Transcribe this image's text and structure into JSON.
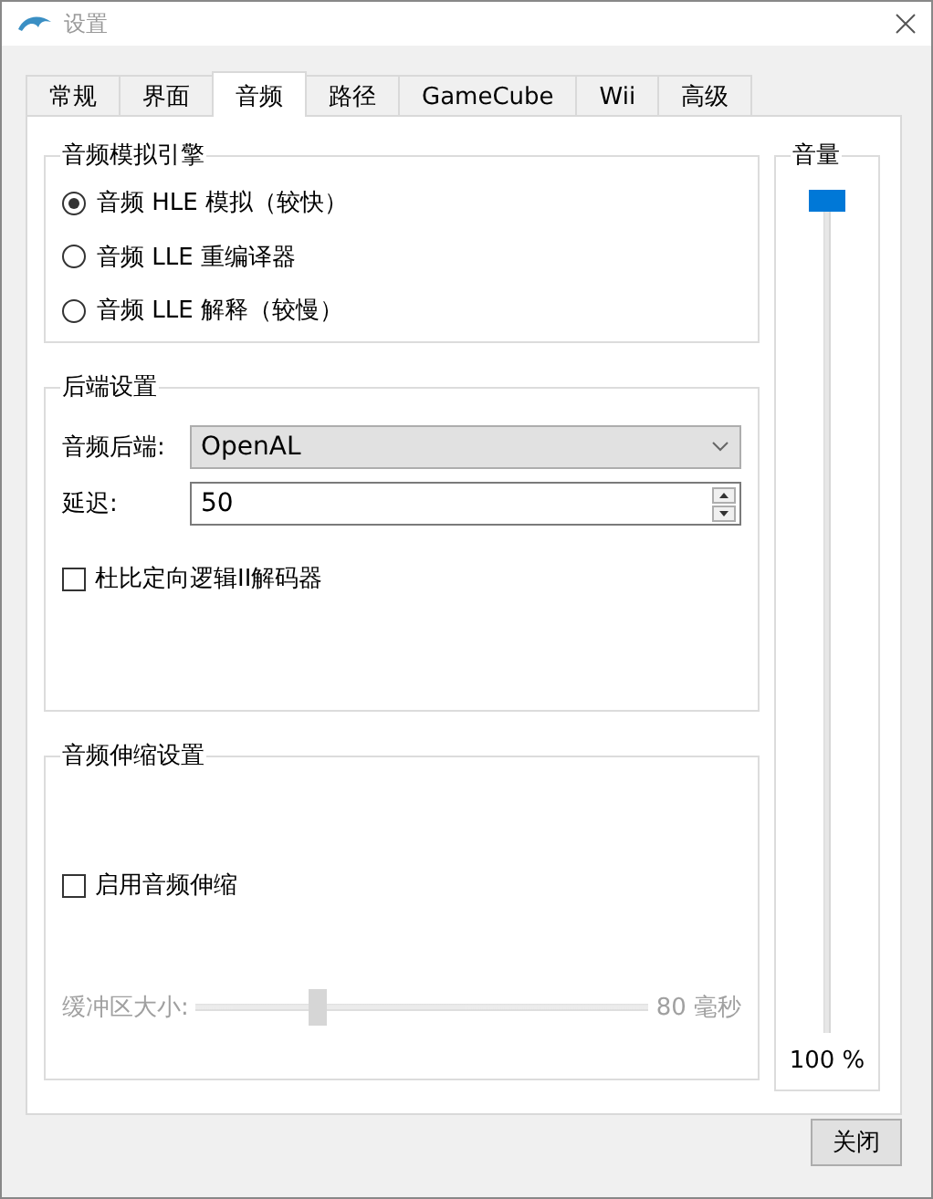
{
  "window": {
    "title": "设置"
  },
  "tabs": [
    {
      "label": "常规",
      "selected": false
    },
    {
      "label": "界面",
      "selected": false
    },
    {
      "label": "音频",
      "selected": true
    },
    {
      "label": "路径",
      "selected": false
    },
    {
      "label": "GameCube",
      "selected": false
    },
    {
      "label": "Wii",
      "selected": false
    },
    {
      "label": "高级",
      "selected": false
    }
  ],
  "audio_engine": {
    "title": "音频模拟引擎",
    "options": [
      {
        "label": "音频 HLE 模拟（较快）",
        "selected": true
      },
      {
        "label": "音频 LLE 重编译器",
        "selected": false
      },
      {
        "label": "音频 LLE 解释（较慢）",
        "selected": false
      }
    ]
  },
  "backend": {
    "title": "后端设置",
    "backend_label": "音频后端:",
    "backend_value": "OpenAL",
    "latency_label": "延迟:",
    "latency_value": "50",
    "dpl2": {
      "label": "杜比定向逻辑II解码器",
      "checked": false
    }
  },
  "stretch": {
    "title": "音频伸缩设置",
    "enable": {
      "label": "启用音频伸缩",
      "checked": false
    },
    "buffer": {
      "label": "缓冲区大小:",
      "level": 0.26,
      "reading": "80 毫秒",
      "disabled": true
    }
  },
  "volume": {
    "title": "音量",
    "level": 1,
    "reading": "100 %"
  },
  "buttons": [
    {
      "label": "关闭"
    }
  ]
}
